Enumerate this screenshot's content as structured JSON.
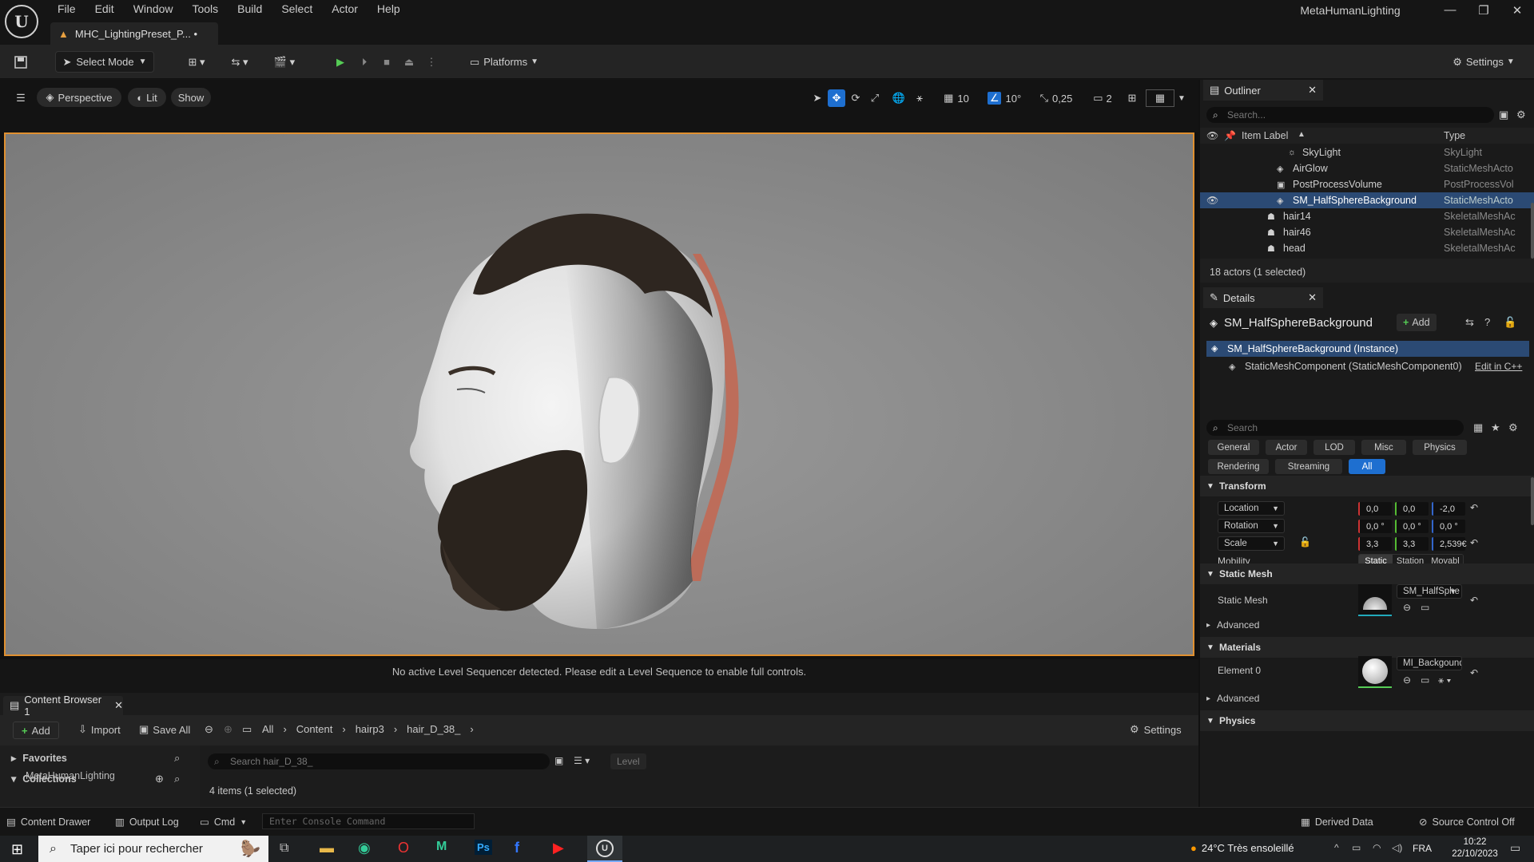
{
  "app": {
    "title": "MetaHumanLighting",
    "document_tab": "MHC_LightingPreset_P... •",
    "menu": [
      "File",
      "Edit",
      "Window",
      "Tools",
      "Build",
      "Select",
      "Actor",
      "Help"
    ]
  },
  "toolbar": {
    "select_mode": "Select Mode",
    "platforms": "Platforms",
    "settings": "Settings"
  },
  "viewport": {
    "perspective": "Perspective",
    "lit": "Lit",
    "show": "Show",
    "grid_size": "10",
    "angle_snap": "10°",
    "scale_snap": "0,25",
    "camera_speed": "2",
    "level_message": "No active Level Sequencer detected. Please edit a Level Sequence to enable full controls."
  },
  "outliner": {
    "tab": "Outliner",
    "search_placeholder": "Search...",
    "col_label": "Item Label",
    "col_type": "Type",
    "items": [
      {
        "label": "SkyLight",
        "type": "SkyLight"
      },
      {
        "label": "AirGlow",
        "type": "StaticMeshActo"
      },
      {
        "label": "PostProcessVolume",
        "type": "PostProcessVol"
      },
      {
        "label": "SM_HalfSphereBackground",
        "type": "StaticMeshActo"
      },
      {
        "label": "hair14",
        "type": "SkeletalMeshAc"
      },
      {
        "label": "hair46",
        "type": "SkeletalMeshAc"
      },
      {
        "label": "head",
        "type": "SkeletalMeshAc"
      }
    ],
    "count": "18 actors (1 selected)"
  },
  "details": {
    "tab": "Details",
    "actor_name": "SM_HalfSphereBackground",
    "add": "Add",
    "instance": "SM_HalfSphereBackground (Instance)",
    "component": "StaticMeshComponent (StaticMeshComponent0)",
    "edit_cpp": "Edit in C++",
    "search_placeholder": "Search",
    "filters_row1": [
      "General",
      "Actor",
      "LOD",
      "Misc",
      "Physics"
    ],
    "filters_row2": [
      "Rendering",
      "Streaming",
      "All"
    ],
    "transform": {
      "title": "Transform",
      "location_label": "Location",
      "location": [
        "0,0",
        "0,0",
        "-2,0"
      ],
      "rotation_label": "Rotation",
      "rotation": [
        "0,0 °",
        "0,0 °",
        "0,0 °"
      ],
      "scale_label": "Scale",
      "scale": [
        "3,3",
        "3,3",
        "2,539€"
      ],
      "mobility_label": "Mobility",
      "mobility": [
        "Static",
        "Station",
        "Movabl"
      ]
    },
    "static_mesh": {
      "title": "Static Mesh",
      "label": "Static Mesh",
      "value": "SM_HalfSphe",
      "advanced": "Advanced"
    },
    "materials": {
      "title": "Materials",
      "element_label": "Element 0",
      "value": "MI_BackgoundPlan",
      "advanced": "Advanced"
    },
    "physics": {
      "title": "Physics"
    }
  },
  "content_browser": {
    "tab": "Content Browser 1",
    "add": "Add",
    "import": "Import",
    "save_all": "Save All",
    "breadcrumbs": [
      "All",
      "Content",
      "hairp3",
      "hair_D_38_"
    ],
    "settings": "Settings",
    "favorites": "Favorites",
    "collections": "Collections",
    "collection_overlay": "MetaHumanLighting",
    "search_placeholder": "Search hair_D_38_",
    "level_filter": "Level",
    "items_count": "4 items (1 selected)"
  },
  "statusbar": {
    "content_drawer": "Content Drawer",
    "output_log": "Output Log",
    "cmd": "Cmd",
    "console_placeholder": "Enter Console Command",
    "derived_data": "Derived Data",
    "source_control": "Source Control Off"
  },
  "taskbar": {
    "search_placeholder": "Taper ici pour rechercher",
    "weather": "24°C  Très ensoleillé",
    "lang": "FRA",
    "time": "10:22",
    "date": "22/10/2023"
  },
  "colors": {
    "accent": "#1e6fd0",
    "selection_outline": "#e09030",
    "panel": "#1a1a1a"
  }
}
